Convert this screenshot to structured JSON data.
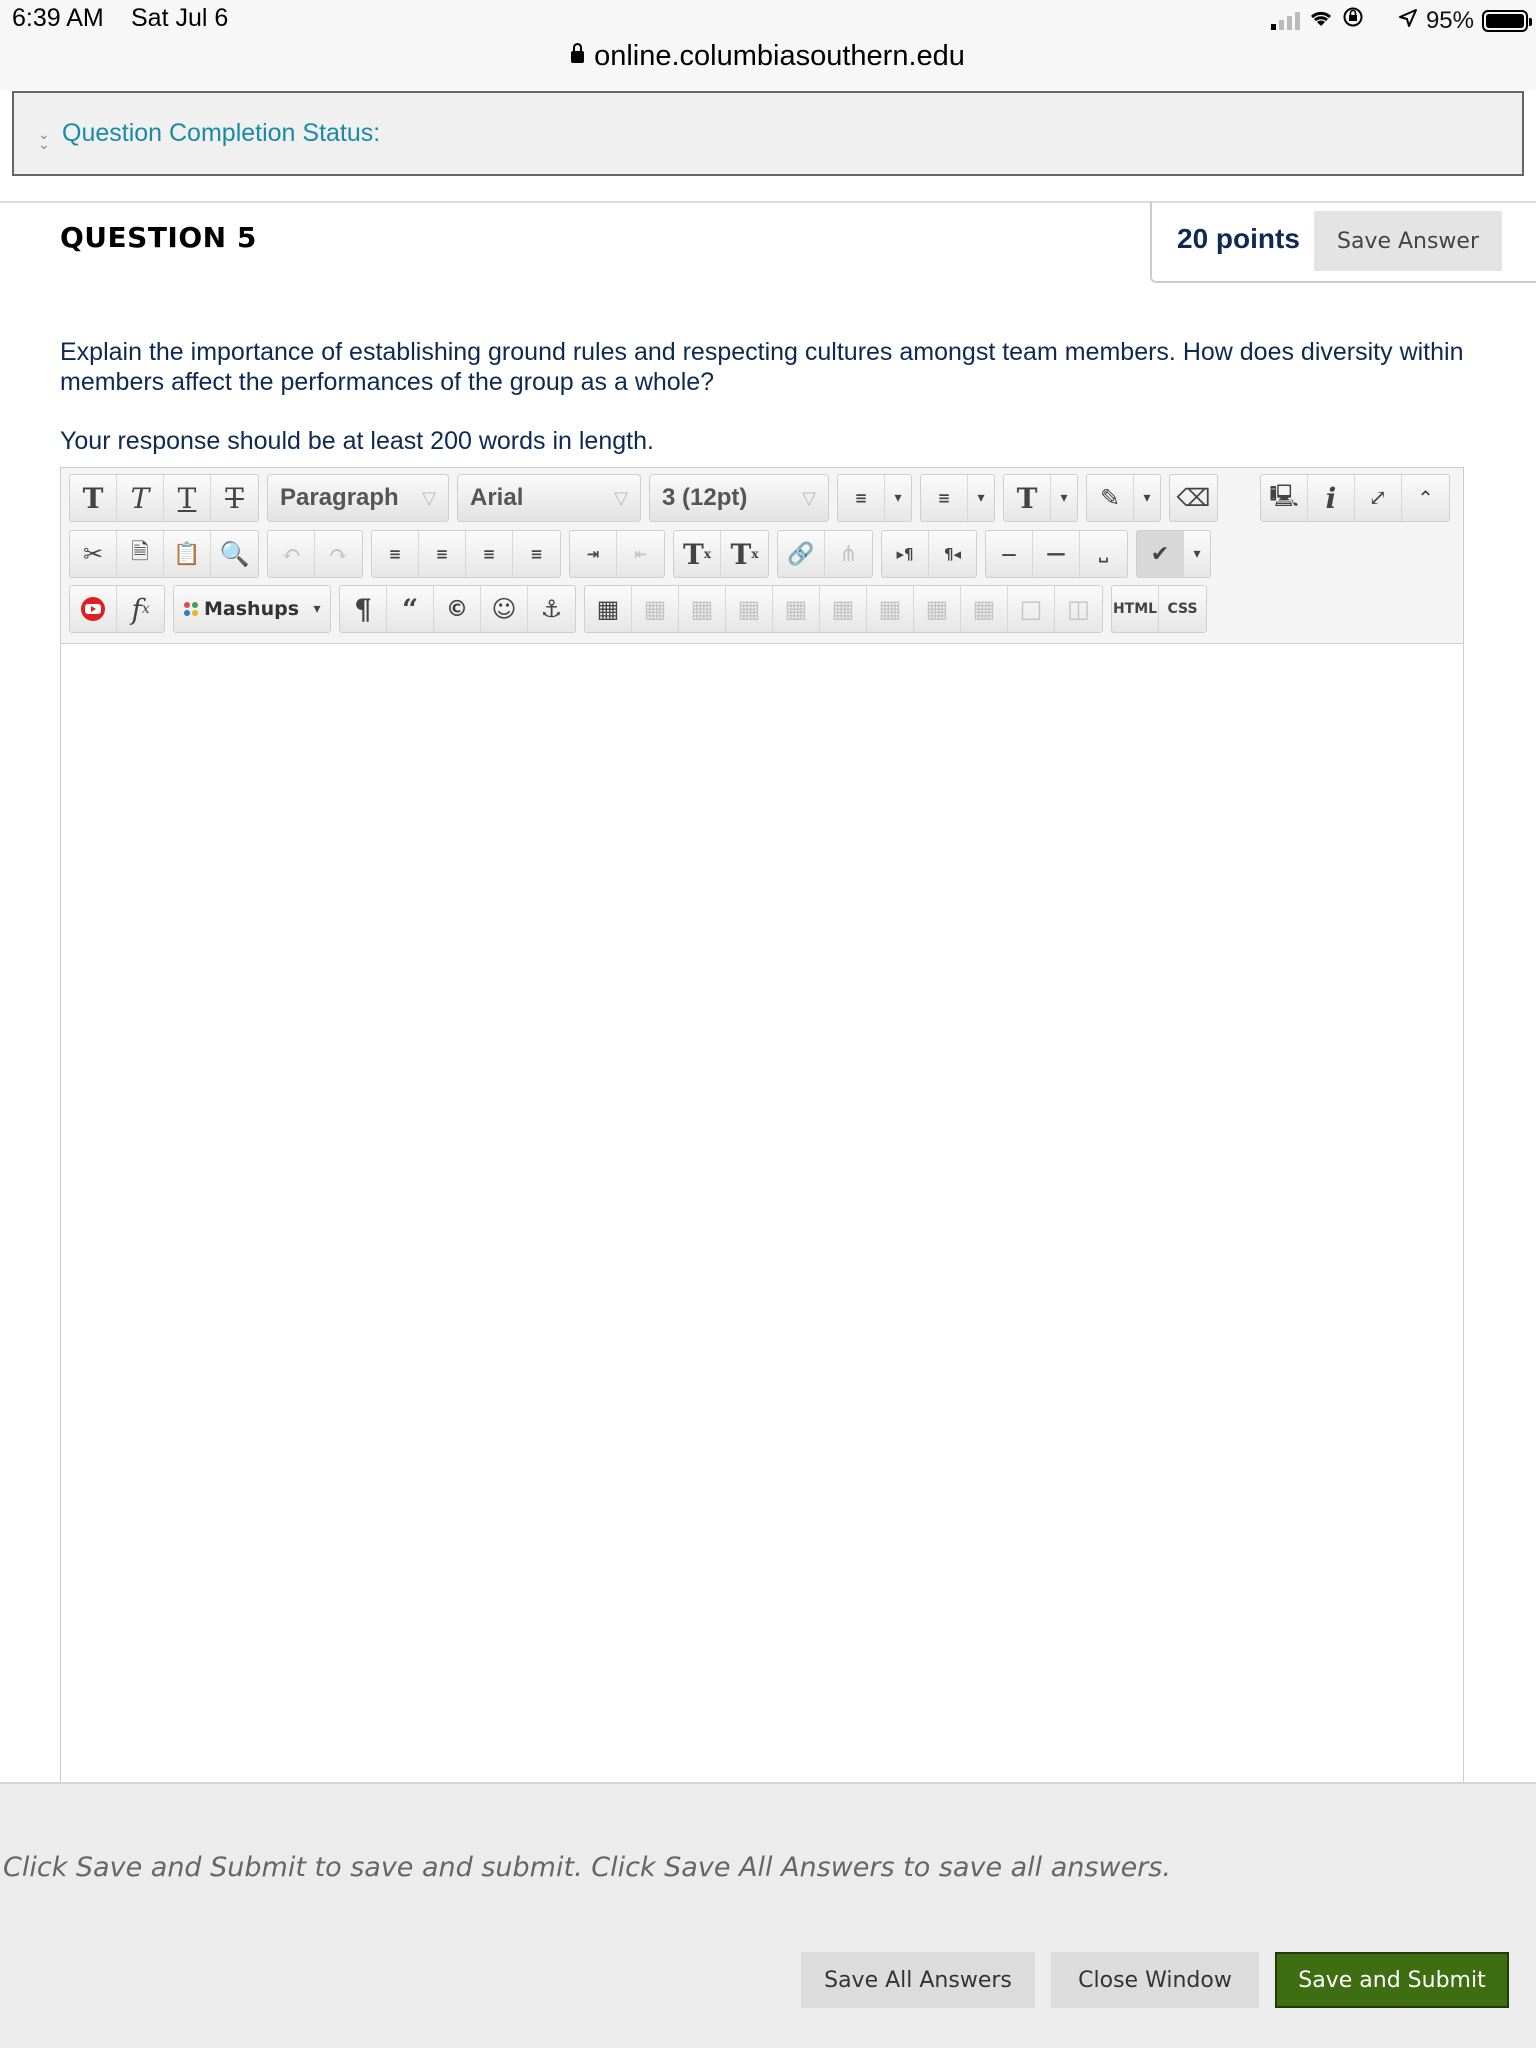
{
  "status_bar": {
    "time": "6:39 AM",
    "date": "Sat Jul 6",
    "battery": "95%",
    "url": "online.columbiasouthern.edu"
  },
  "completion_status": {
    "label": "Question Completion Status:"
  },
  "question": {
    "title": "QUESTION 5",
    "points": "20 points",
    "save_answer_label": "Save Answer",
    "text": "Explain the importance of establishing ground rules and respecting cultures amongst team members. How does diversity within members affect the performances of the group as a whole?",
    "instruction": "Your response should be at least 200 words in length."
  },
  "editor": {
    "paragraph_select": "Paragraph",
    "font_select": "Arial",
    "size_select": "3 (12pt)",
    "mashups_label": "Mashups",
    "html_label": "HTML",
    "css_label": "CSS",
    "content": ""
  },
  "footer": {
    "message": "Click Save and Submit to save and submit. Click Save All Answers to save all answers.",
    "save_all_label": "Save All Answers",
    "close_label": "Close Window",
    "submit_label": "Save and Submit"
  },
  "colors": {
    "link_teal": "#1a8aa6",
    "question_navy": "#0d2a52",
    "submit_green": "#3e6d12"
  }
}
